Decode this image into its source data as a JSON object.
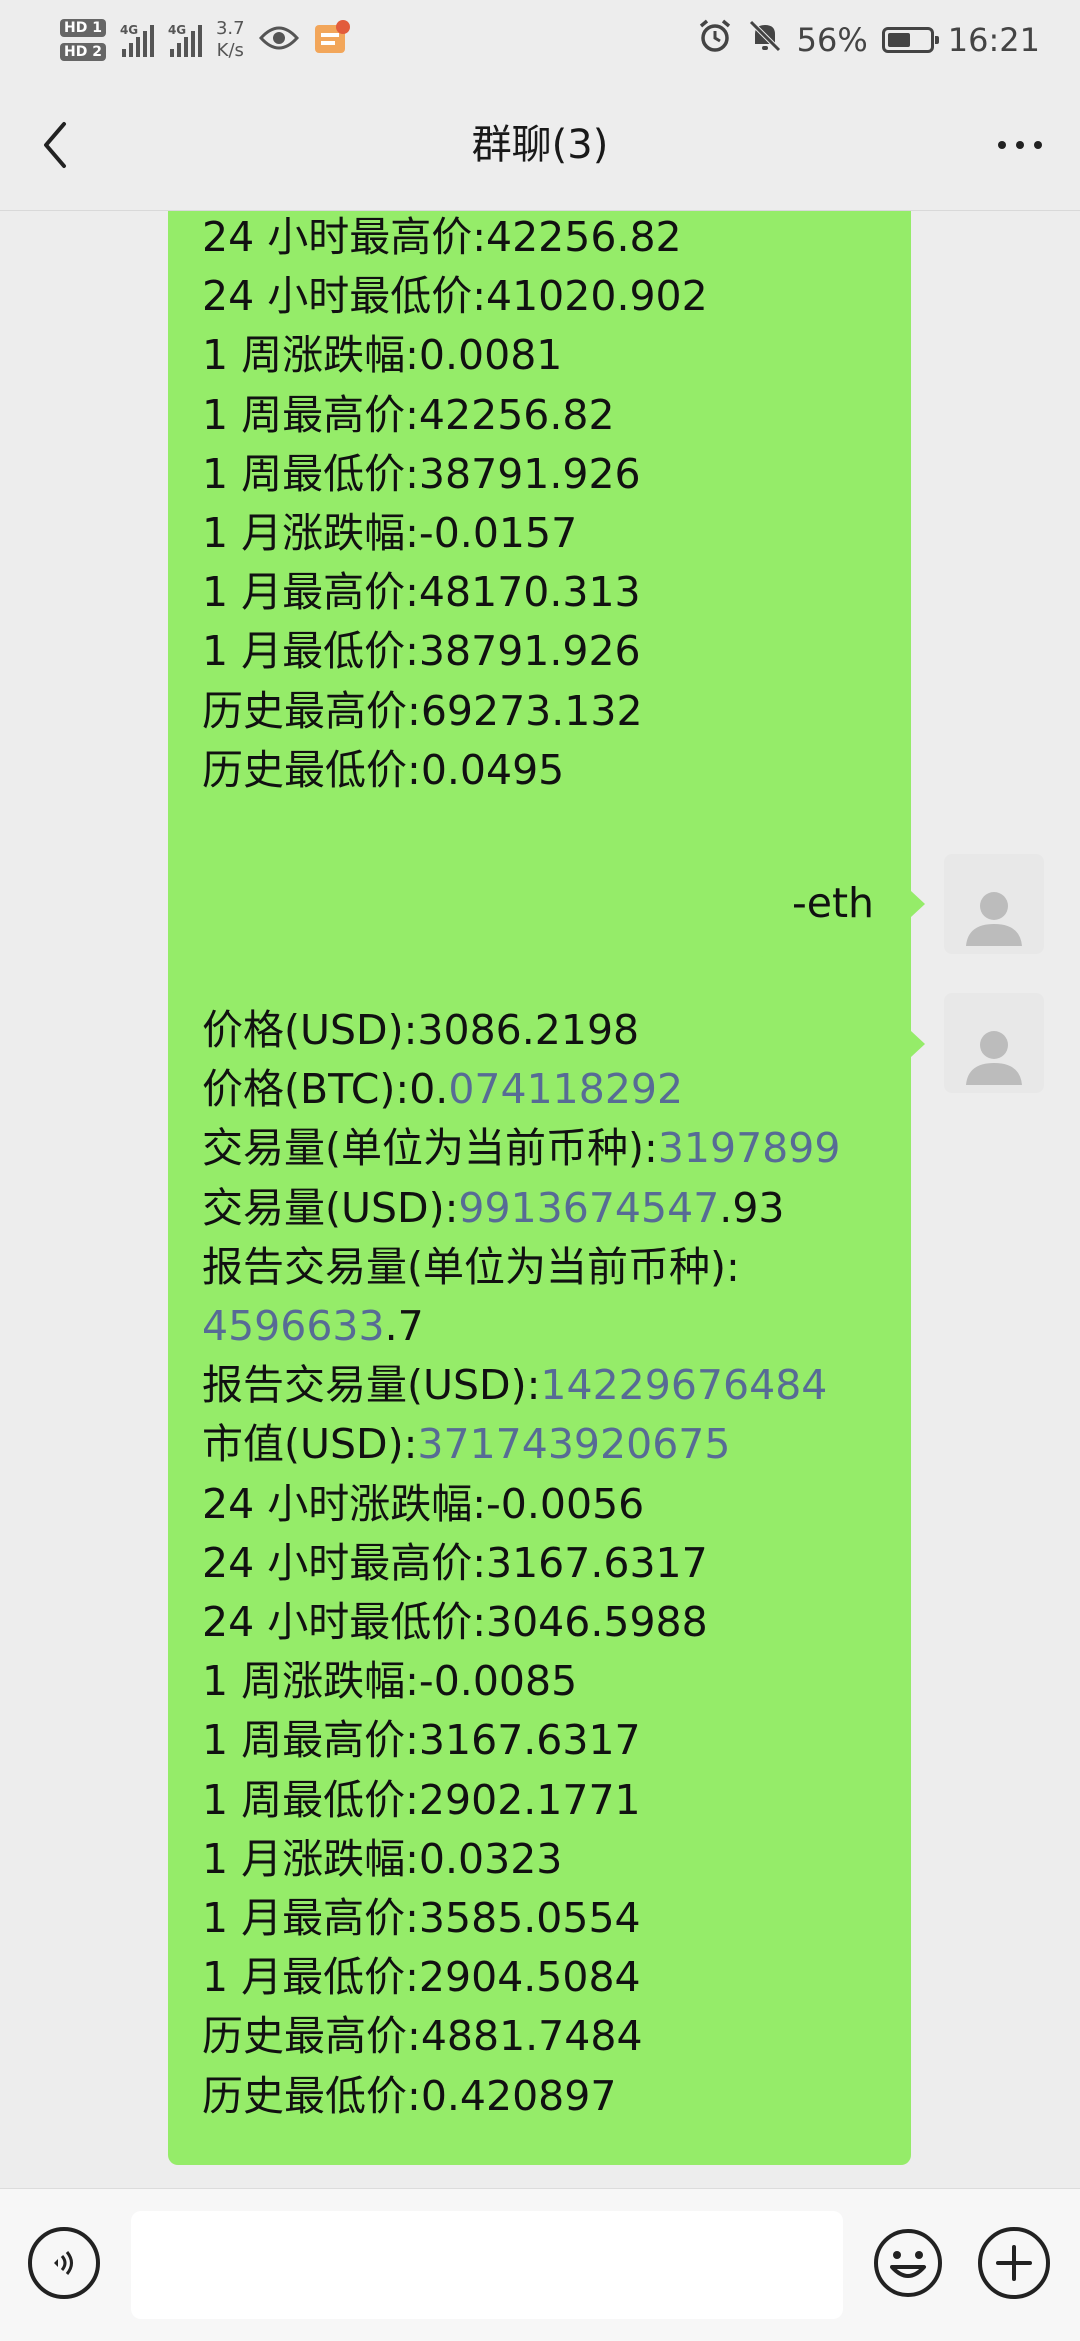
{
  "status_bar": {
    "hd1": "HD 1",
    "hd2": "HD 2",
    "sim1_label": "4G",
    "sim2_label": "4G",
    "net_speed_value": "3.7",
    "net_speed_unit": "K/s",
    "battery_percent": "56%",
    "battery_level": 0.56,
    "time": "16:21",
    "icons": [
      "eye-icon",
      "app-notification-icon",
      "alarm-icon",
      "mute-icon"
    ]
  },
  "nav": {
    "title": "群聊(3)"
  },
  "messages": {
    "first": {
      "lines": [
        "24 小时最高价:42256.82",
        "24 小时最低价:41020.902",
        "1 周涨跌幅:0.0081",
        "1 周最高价:42256.82",
        "1 周最低价:38791.926",
        "1 月涨跌幅:-0.0157",
        "1 月最高价:48170.313",
        "1 月最低价:38791.926",
        "历史最高价:69273.132",
        "历史最低价:0.0495"
      ]
    },
    "command": {
      "text": "-eth"
    },
    "second": {
      "price_usd": "价格(USD):3086.2198",
      "price_btc_pre": "价格(BTC):0.",
      "price_btc_link": "074118292",
      "volume_pre": "交易量(单位为当前币种):",
      "volume_link": "3197899",
      "volume_usd_pre": "交易量(USD):",
      "volume_usd_link": "9913674547",
      "volume_usd_post": ".93",
      "reported_volume_label": "报告交易量(单位为当前币种):",
      "reported_volume_link": "4596633",
      "reported_volume_post": ".7",
      "reported_volume_usd_pre": "报告交易量(USD):",
      "reported_volume_usd_link": "14229676484",
      "market_cap_pre": "市值(USD):",
      "market_cap_link": "371743920675",
      "lines": [
        "24 小时涨跌幅:-0.0056",
        "24 小时最高价:3167.6317",
        "24 小时最低价:3046.5988",
        "1 周涨跌幅:-0.0085",
        "1 周最高价:3167.6317",
        "1 周最低价:2902.1771",
        "1 月涨跌幅:0.0323",
        "1 月最高价:3585.0554",
        "1 月最低价:2904.5084",
        "历史最高价:4881.7484",
        "历史最低价:0.420897"
      ]
    }
  },
  "input_bar": {
    "placeholder": "",
    "icons": [
      "voice-icon",
      "emoji-icon",
      "plus-icon"
    ]
  },
  "colors": {
    "bubble": "#95ec69",
    "link": "#576b95",
    "background": "#ededed"
  }
}
